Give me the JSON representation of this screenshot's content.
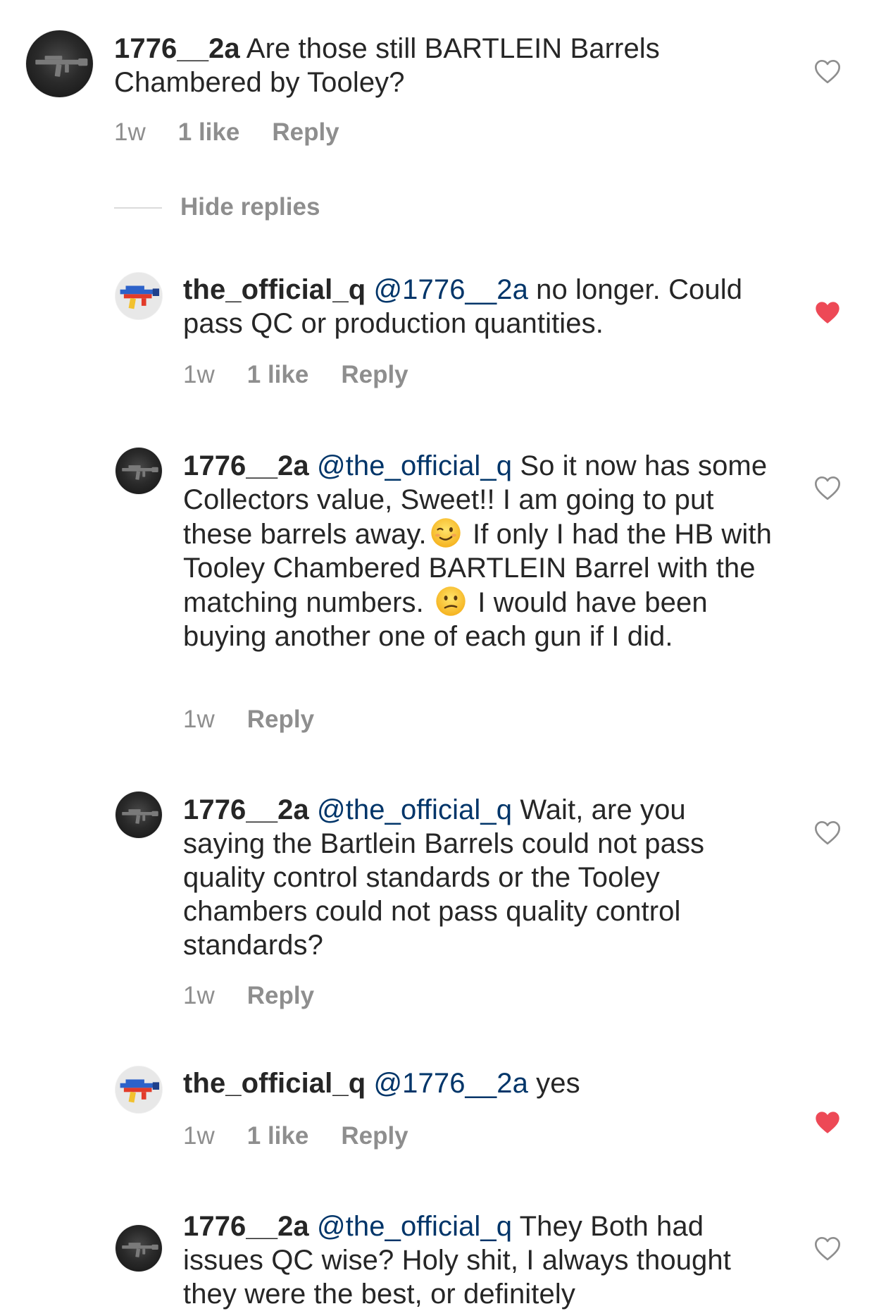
{
  "comments": [
    {
      "username": "1776__2a",
      "mention": "",
      "text_parts": [
        " Are those still BARTLEIN Barrels Chambered by Tooley?"
      ],
      "time": "1w",
      "likes": "1 like",
      "reply": "Reply",
      "liked": false
    },
    {
      "username": "the_official_q",
      "mention": "@1776__2a",
      "text_parts": [
        " no longer. Could pass QC or production quantities."
      ],
      "time": "1w",
      "likes": "1 like",
      "reply": "Reply",
      "liked": true
    },
    {
      "username": "1776__2a",
      "mention": "@the_official_q",
      "text_parts": [
        "  So it now has some Collectors value, Sweet!! I am going to put these barrels away.",
        " If only I had the HB with Tooley Chambered BARTLEIN Barrel with the matching numbers. ",
        " I would have been buying another one of each gun if I did."
      ],
      "time": "1w",
      "likes": "",
      "reply": "Reply",
      "liked": false
    },
    {
      "username": "1776__2a",
      "mention": "@the_official_q",
      "text_parts": [
        " Wait, are you saying the Bartlein Barrels could not pass quality control standards or the Tooley chambers could not pass quality control standards?"
      ],
      "time": "1w",
      "likes": "",
      "reply": "Reply",
      "liked": false
    },
    {
      "username": "the_official_q",
      "mention": "@1776__2a",
      "text_parts": [
        " yes"
      ],
      "time": "1w",
      "likes": "1 like",
      "reply": "Reply",
      "liked": true
    },
    {
      "username": "1776__2a",
      "mention": "@the_official_q",
      "text_parts": [
        " They Both had issues QC wise? Holy shit, I always thought they were the best, or definitely"
      ],
      "time": "",
      "likes": "",
      "reply": "",
      "liked": false
    }
  ],
  "hide_replies_label": "Hide replies",
  "icons": {
    "heart_outline": "heart-outline-icon",
    "heart_filled": "heart-filled-icon",
    "emoji_wink": "winking-face-emoji",
    "emoji_confused": "confused-face-emoji"
  },
  "colors": {
    "text": "#262626",
    "mention": "#003569",
    "meta": "#8e8e8e",
    "liked_heart": "#ed4956"
  }
}
